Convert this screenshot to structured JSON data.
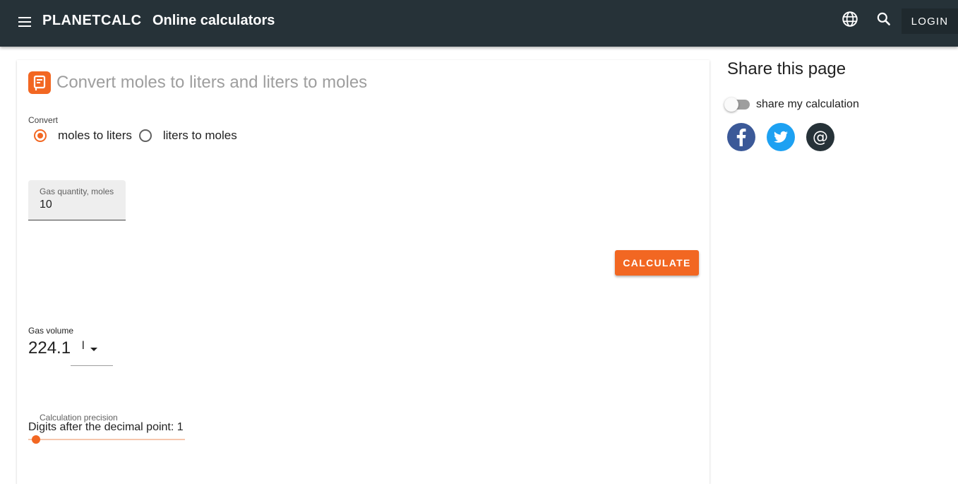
{
  "header": {
    "brand": "PLANETCALC",
    "section": "Online calculators",
    "login_label": "LOGIN",
    "icons": [
      "menu-icon",
      "globe-icon",
      "search-icon"
    ],
    "background_color": "#263238"
  },
  "calculator": {
    "title": "Convert moles to liters and liters to moles",
    "accent_color": "#f26722",
    "convert": {
      "label": "Convert",
      "options": [
        {
          "label": "moles to liters",
          "selected": true
        },
        {
          "label": "liters to moles",
          "selected": false
        }
      ]
    },
    "input": {
      "label": "Gas quantity, moles",
      "value": "10"
    },
    "calculate_label": "CALCULATE",
    "result": {
      "label": "Gas volume",
      "value": "224.1",
      "unit": "l"
    },
    "precision": {
      "label": "Calculation precision",
      "text": "Digits after the decimal point: 1",
      "value": 1
    }
  },
  "share": {
    "title": "Share this page",
    "toggle_label": "share my calculation",
    "toggle_on": false,
    "buttons": [
      "facebook-icon",
      "twitter-icon",
      "email-icon"
    ]
  }
}
